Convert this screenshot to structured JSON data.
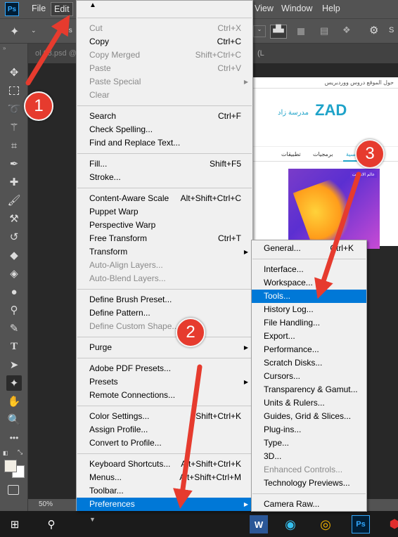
{
  "app": {
    "logo": "Ps"
  },
  "menubar": {
    "file": "File",
    "edit": "Edit",
    "view": "View",
    "window": "Window",
    "help": "Help"
  },
  "optbar": {
    "labels_fragment": "els",
    "workspace_fragment": "S"
  },
  "docbar": {
    "tab_fragment": "(L",
    "tab_fragment_left": "ol 03.psd @"
  },
  "statusbar": {
    "zoom": "50%"
  },
  "edit_menu": {
    "top_arrow": "▲",
    "groups": [
      [
        {
          "label": "Cut",
          "shortcut": "Ctrl+X",
          "disabled": true
        },
        {
          "label": "Copy",
          "shortcut": "Ctrl+C",
          "disabled": false
        },
        {
          "label": "Copy Merged",
          "shortcut": "Shift+Ctrl+C",
          "disabled": true
        },
        {
          "label": "Paste",
          "shortcut": "Ctrl+V",
          "disabled": true
        },
        {
          "label": "Paste Special",
          "shortcut": "",
          "disabled": true,
          "submenu": true
        },
        {
          "label": "Clear",
          "shortcut": "",
          "disabled": true
        }
      ],
      [
        {
          "label": "Search",
          "shortcut": "Ctrl+F",
          "disabled": false
        },
        {
          "label": "Check Spelling...",
          "shortcut": "",
          "disabled": false
        },
        {
          "label": "Find and Replace Text...",
          "shortcut": "",
          "disabled": false
        }
      ],
      [
        {
          "label": "Fill...",
          "shortcut": "Shift+F5",
          "disabled": false
        },
        {
          "label": "Stroke...",
          "shortcut": "",
          "disabled": false
        }
      ],
      [
        {
          "label": "Content-Aware Scale",
          "shortcut": "Alt+Shift+Ctrl+C",
          "disabled": false
        },
        {
          "label": "Puppet Warp",
          "shortcut": "",
          "disabled": false
        },
        {
          "label": "Perspective Warp",
          "shortcut": "",
          "disabled": false
        },
        {
          "label": "Free Transform",
          "shortcut": "Ctrl+T",
          "disabled": false
        },
        {
          "label": "Transform",
          "shortcut": "",
          "disabled": false,
          "submenu": true
        },
        {
          "label": "Auto-Align Layers...",
          "shortcut": "",
          "disabled": true
        },
        {
          "label": "Auto-Blend Layers...",
          "shortcut": "",
          "disabled": true
        }
      ],
      [
        {
          "label": "Define Brush Preset...",
          "shortcut": "",
          "disabled": false
        },
        {
          "label": "Define Pattern...",
          "shortcut": "",
          "disabled": false
        },
        {
          "label": "Define Custom Shape...",
          "shortcut": "",
          "disabled": true
        }
      ],
      [
        {
          "label": "Purge",
          "shortcut": "",
          "disabled": false,
          "submenu": true
        }
      ],
      [
        {
          "label": "Adobe PDF Presets...",
          "shortcut": "",
          "disabled": false
        },
        {
          "label": "Presets",
          "shortcut": "",
          "disabled": false,
          "submenu": true
        },
        {
          "label": "Remote Connections...",
          "shortcut": "",
          "disabled": false
        }
      ],
      [
        {
          "label": "Color Settings...",
          "shortcut": "Shift+Ctrl+K",
          "disabled": false
        },
        {
          "label": "Assign Profile...",
          "shortcut": "",
          "disabled": false
        },
        {
          "label": "Convert to Profile...",
          "shortcut": "",
          "disabled": false
        }
      ],
      [
        {
          "label": "Keyboard Shortcuts...",
          "shortcut": "Alt+Shift+Ctrl+K",
          "disabled": false
        },
        {
          "label": "Menus...",
          "shortcut": "Alt+Shift+Ctrl+M",
          "disabled": false
        },
        {
          "label": "Toolbar...",
          "shortcut": "",
          "disabled": false
        },
        {
          "label": "Preferences",
          "shortcut": "",
          "disabled": false,
          "submenu": true,
          "highlighted": true
        }
      ]
    ],
    "bottom_arrow": "▼"
  },
  "preferences_menu": {
    "groups": [
      [
        {
          "label": "General...",
          "shortcut": "Ctrl+K",
          "disabled": false
        }
      ],
      [
        {
          "label": "Interface...",
          "disabled": false
        },
        {
          "label": "Workspace...",
          "disabled": false
        },
        {
          "label": "Tools...",
          "disabled": false,
          "highlighted": true
        },
        {
          "label": "History Log...",
          "disabled": false
        },
        {
          "label": "File Handling...",
          "disabled": false
        },
        {
          "label": "Export...",
          "disabled": false
        },
        {
          "label": "Performance...",
          "disabled": false
        },
        {
          "label": "Scratch Disks...",
          "disabled": false
        },
        {
          "label": "Cursors...",
          "disabled": false
        },
        {
          "label": "Transparency & Gamut...",
          "disabled": false
        },
        {
          "label": "Units & Rulers...",
          "disabled": false
        },
        {
          "label": "Guides, Grid & Slices...",
          "disabled": false
        },
        {
          "label": "Plug-ins...",
          "disabled": false
        },
        {
          "label": "Type...",
          "disabled": false
        },
        {
          "label": "3D...",
          "disabled": false
        },
        {
          "label": "Enhanced Controls...",
          "disabled": true
        },
        {
          "label": "Technology Previews...",
          "disabled": false
        }
      ],
      [
        {
          "label": "Camera Raw...",
          "disabled": false
        }
      ]
    ]
  },
  "annotations": {
    "step1": "1",
    "step2": "2",
    "step3": "3",
    "color": "#e63b2e"
  },
  "website": {
    "topbar_text": "حول الموقع  دروس ووردبريس",
    "logo_mark": "ZAD",
    "logo_text": "مدرسة زاد",
    "nav_home": "الرئيسية",
    "nav_software": "برمجيات",
    "nav_apps": "تطبيقات",
    "card_tag": "عالم الانترنت"
  },
  "colors": {
    "menu_highlight": "#0078d7",
    "ps_blue": "#31a8ff"
  }
}
